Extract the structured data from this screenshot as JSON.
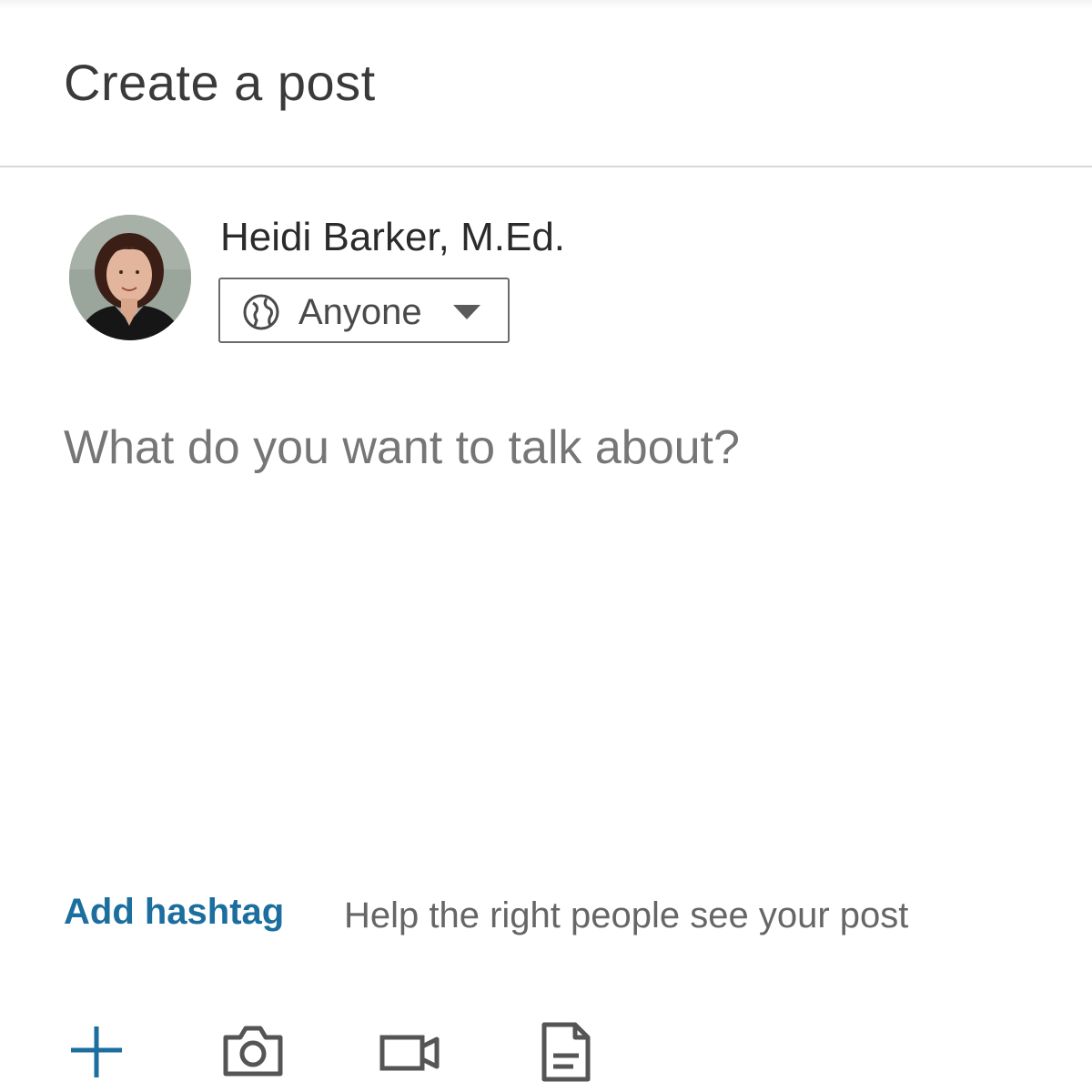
{
  "header": {
    "title": "Create a post"
  },
  "author": {
    "name": "Heidi Barker, M.Ed.",
    "avatar_icon": "user-photo"
  },
  "visibility": {
    "label": "Anyone",
    "icon": "globe-icon"
  },
  "composer": {
    "placeholder": "What do you want to talk about?",
    "value": ""
  },
  "hashtag": {
    "link_label": "Add hashtag",
    "hint": "Help the right people see your post"
  },
  "toolbar": {
    "items": [
      {
        "icon": "plus-icon",
        "color": "#1b6e9e"
      },
      {
        "icon": "camera-icon",
        "color": "#555555"
      },
      {
        "icon": "video-icon",
        "color": "#555555"
      },
      {
        "icon": "document-icon",
        "color": "#555555"
      }
    ]
  },
  "colors": {
    "accent": "#1b6e9e",
    "divider": "#d9d9d9",
    "text": "#2b2b2b",
    "muted": "#767676"
  }
}
